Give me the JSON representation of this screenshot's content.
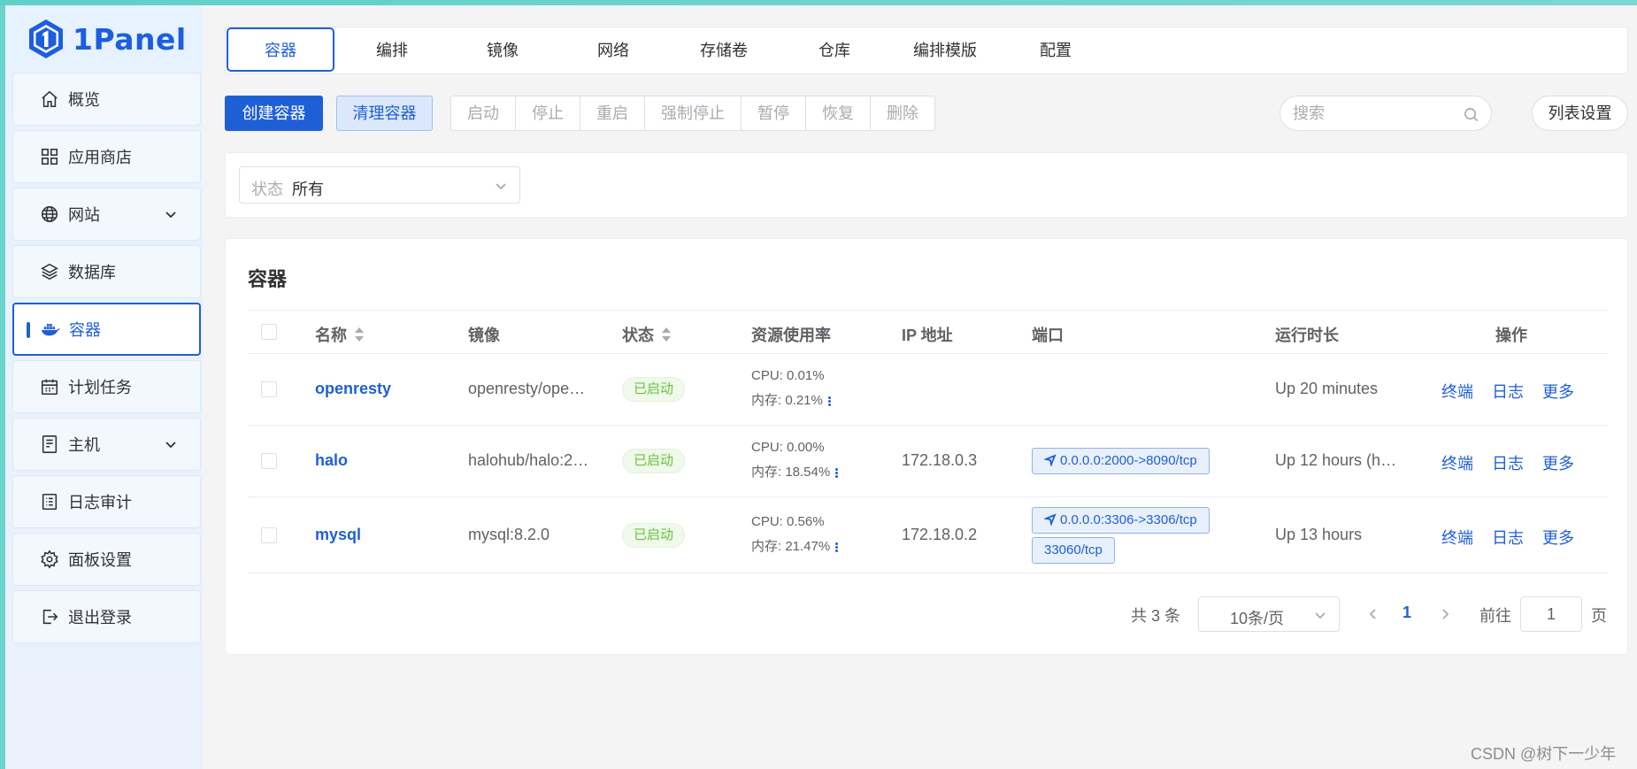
{
  "app": {
    "logo_text": "1Panel"
  },
  "sidebar": {
    "items": [
      {
        "label": "概览",
        "icon": "home-icon"
      },
      {
        "label": "应用商店",
        "icon": "grid-icon"
      },
      {
        "label": "网站",
        "icon": "globe-icon",
        "expandable": true
      },
      {
        "label": "数据库",
        "icon": "layers-icon"
      },
      {
        "label": "容器",
        "icon": "docker-icon",
        "active": true
      },
      {
        "label": "计划任务",
        "icon": "calendar-icon"
      },
      {
        "label": "主机",
        "icon": "server-icon",
        "expandable": true
      },
      {
        "label": "日志审计",
        "icon": "log-icon"
      },
      {
        "label": "面板设置",
        "icon": "gear-icon"
      },
      {
        "label": "退出登录",
        "icon": "logout-icon"
      }
    ]
  },
  "tabs": [
    "容器",
    "编排",
    "镜像",
    "网络",
    "存储卷",
    "仓库",
    "编排模版",
    "配置"
  ],
  "toolbar": {
    "create_label": "创建容器",
    "clean_label": "清理容器",
    "actions": [
      "启动",
      "停止",
      "重启",
      "强制停止",
      "暂停",
      "恢复",
      "删除"
    ],
    "search_placeholder": "搜索",
    "list_settings_label": "列表设置"
  },
  "filter": {
    "status_label": "状态",
    "status_value": "所有"
  },
  "table": {
    "title": "容器",
    "headers": [
      "名称",
      "镜像",
      "状态",
      "资源使用率",
      "IP 地址",
      "端口",
      "运行时长",
      "操作"
    ],
    "rows": [
      {
        "name": "openresty",
        "image": "openresty/ope…",
        "status": "已启动",
        "cpu": "CPU: 0.01%",
        "mem": "内存: 0.21%",
        "ip": "",
        "ports": [],
        "uptime": "Up 20 minutes"
      },
      {
        "name": "halo",
        "image": "halohub/halo:2…",
        "status": "已启动",
        "cpu": "CPU: 0.00%",
        "mem": "内存: 18.54%",
        "ip": "172.18.0.3",
        "ports": [
          "0.0.0.0:2000->8090/tcp"
        ],
        "uptime": "Up 12 hours (h…"
      },
      {
        "name": "mysql",
        "image": "mysql:8.2.0",
        "status": "已启动",
        "cpu": "CPU: 0.56%",
        "mem": "内存: 21.47%",
        "ip": "172.18.0.2",
        "ports": [
          "0.0.0.0:3306->3306/tcp",
          "33060/tcp"
        ],
        "uptime": "Up 13 hours"
      }
    ],
    "row_actions": [
      "终端",
      "日志",
      "更多"
    ]
  },
  "pagination": {
    "total_text": "共 3 条",
    "page_size": "10条/页",
    "current_page": "1",
    "goto_label": "前往",
    "goto_value": "1",
    "page_unit": "页"
  },
  "watermark": "CSDN @树下一少年",
  "colors": {
    "primary": "#1f5fd6",
    "success": "#67c23a",
    "sidebar_bg": "#e6f2ff"
  }
}
